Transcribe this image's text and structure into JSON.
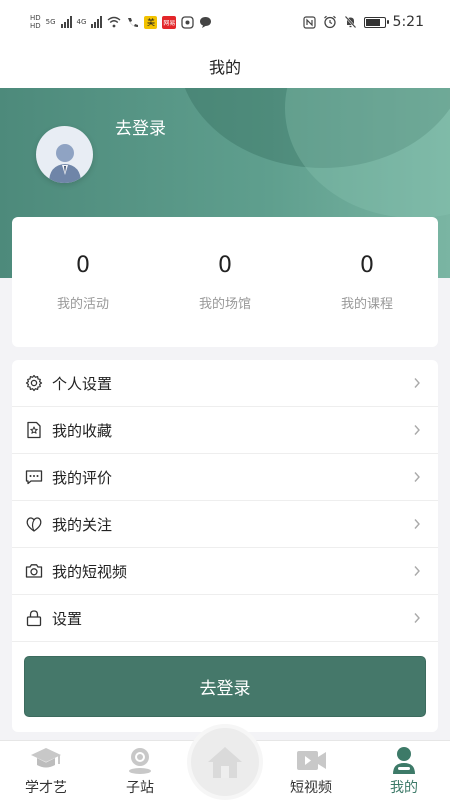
{
  "status_bar": {
    "time": "5:21",
    "network_1": "5G",
    "network_2": "4G",
    "hd_label": "HD",
    "badge_mei": "美",
    "badge_red": "网易"
  },
  "header": {
    "title": "我的"
  },
  "profile": {
    "login_text": "去登录",
    "avatar": "user-avatar"
  },
  "stats": [
    {
      "value": "0",
      "label": "我的活动"
    },
    {
      "value": "0",
      "label": "我的场馆"
    },
    {
      "value": "0",
      "label": "我的课程"
    }
  ],
  "menu": [
    {
      "label": "个人设置",
      "icon": "gear-icon"
    },
    {
      "label": "我的收藏",
      "icon": "bookmark-star-icon"
    },
    {
      "label": "我的评价",
      "icon": "comment-icon"
    },
    {
      "label": "我的关注",
      "icon": "heart-icon"
    },
    {
      "label": "我的短视频",
      "icon": "camera-icon"
    },
    {
      "label": "设置",
      "icon": "lock-icon"
    }
  ],
  "login_button": "去登录",
  "tabbar": {
    "items": [
      {
        "label": "学才艺",
        "icon": "graduation-cap-icon"
      },
      {
        "label": "子站",
        "icon": "location-pin-icon"
      },
      {
        "label": "",
        "icon": "home-icon"
      },
      {
        "label": "短视频",
        "icon": "video-icon"
      },
      {
        "label": "我的",
        "icon": "person-icon"
      }
    ],
    "active": "我的"
  },
  "colors": {
    "brand_green": "#45786a",
    "hero_green": "#5f9f8e",
    "active_tab": "#3d7a68",
    "muted_text": "#999999"
  }
}
